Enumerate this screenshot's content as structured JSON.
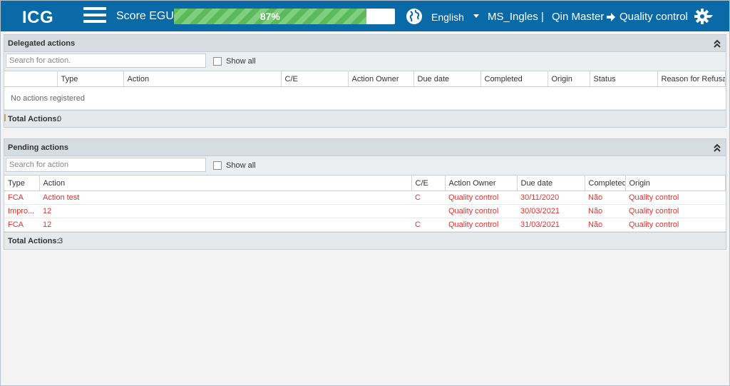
{
  "header": {
    "logo": "ICG",
    "score_label": "Score EGU:",
    "score_value": "87%",
    "score_fraction": 0.87,
    "language": "English",
    "user": "MS_Ingles",
    "separator": "|",
    "breadcrumb": [
      "Qin Master",
      "Quality control"
    ]
  },
  "delegated": {
    "title": "Delegated actions",
    "search_placeholder": "Search for action.",
    "show_all": "Show all",
    "columns": [
      "",
      "Type",
      "Action",
      "C/E",
      "Action Owner",
      "Due date",
      "Completed",
      "Origin",
      "Status",
      "Reason for Refusal"
    ],
    "empty_message": "No actions registered",
    "total_label": "Total Actions:",
    "total_value": "0"
  },
  "pending": {
    "title": "Pending actions",
    "search_placeholder": "Search for action",
    "show_all": "Show all",
    "columns": [
      "Type",
      "Action",
      "C/E",
      "Action Owner",
      "Due date",
      "Completed",
      "Origin"
    ],
    "rows": [
      [
        "FCA",
        "Action test",
        "C",
        "Quality control",
        "30/11/2020",
        "Não",
        "Quality control"
      ],
      [
        "Impro...",
        "12",
        "",
        "Quality control",
        "30/03/2021",
        "Não",
        "Quality control"
      ],
      [
        "FCA",
        "12",
        "C",
        "Quality control",
        "31/03/2021",
        "Não",
        "Quality control"
      ]
    ],
    "total_label": "Total Actions:",
    "total_value": "3"
  },
  "colors": {
    "topbar": "#0a6aa8",
    "pending_text": "#e8312c",
    "progress_green": "#5cba5c"
  }
}
